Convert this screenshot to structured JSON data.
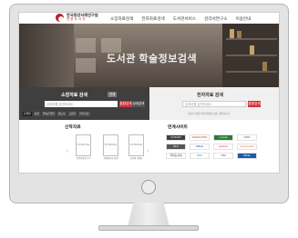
{
  "header": {
    "logo_name": "한국동양서예연구원",
    "logo_sub": "전 문 도 서 관",
    "nav": [
      "소장자료검색",
      "전자자료검색",
      "도서관서비스",
      "감각서연구소",
      "이용안내"
    ]
  },
  "hero": {
    "title": "도서관 학술정보검색"
  },
  "search": {
    "left": {
      "title": "소장자료 검색",
      "badge": "전체",
      "placeholder": "검색어를 입력하세요",
      "button": "통합검색",
      "detail_button": "상세검색",
      "quick_links": [
        "단행본",
        "논문",
        "연속간행물",
        "비도서",
        "고문헌",
        "전자자료"
      ]
    },
    "right": {
      "title": "전자자료 검색",
      "placeholder": "검색어를 입력하세요",
      "button": "통합검색",
      "hint": "학술지 원문 데이터베이스를 검색합니다"
    }
  },
  "new_arrivals": {
    "title": "신착자료",
    "prev": "‹",
    "next": "›",
    "books": [
      {
        "cover": "NOIMAGE",
        "title": "동양서예 연구 1"
      },
      {
        "cover": "NOIMAGE",
        "title": "서예이론과 실제"
      },
      {
        "cover": "NOIMAGE",
        "title": "한국의 서예사"
      }
    ]
  },
  "affiliates": {
    "title": "연계사이트",
    "sites": [
      {
        "label": "KOSTAT",
        "color": "#ffffff",
        "bg": "#3f3f3f"
      },
      {
        "label": "KERIS RISS",
        "color": "#c0392b",
        "bg": "#ffffff"
      },
      {
        "label": "e-book",
        "color": "#ffffff",
        "bg": "#2e7d32"
      },
      {
        "label": "KISS",
        "color": "#1e5aa8",
        "bg": "#ffffff"
      },
      {
        "label": "NLK",
        "color": "#ffffff",
        "bg": "#555555"
      },
      {
        "label": "DBpia",
        "color": "#1e5aa8",
        "bg": "#ffffff"
      },
      {
        "label": "eArticle",
        "color": "#d0343a",
        "bg": "#ffffff"
      },
      {
        "label": "ScienceON",
        "color": "#e67e22",
        "bg": "#ffffff"
      },
      {
        "label": "국회도서관",
        "color": "#333333",
        "bg": "#ffffff"
      },
      {
        "label": "KCI",
        "color": "#1e5aa8",
        "bg": "#ffffff"
      },
      {
        "label": "KSI",
        "color": "#333333",
        "bg": "#ffffff"
      },
      {
        "label": "NDSL",
        "color": "#ffffff",
        "bg": "#1e5aa8"
      }
    ]
  }
}
